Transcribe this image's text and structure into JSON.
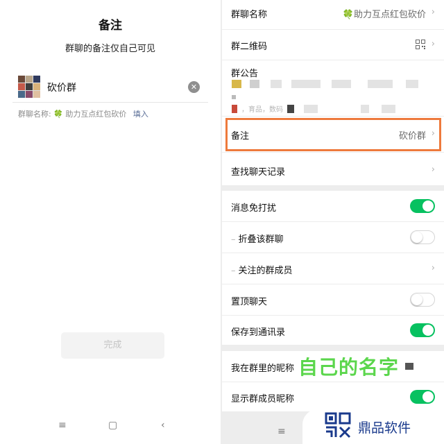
{
  "left": {
    "title": "备注",
    "subtitle": "群聊的备注仅自己可见",
    "remark_value": "砍价群",
    "name_label": "群聊名称:",
    "name_value": "助力互点红包砍价",
    "fill_link": "填入",
    "done_label": "完成",
    "nav": {
      "menu": "≡",
      "home": "▢",
      "back": "‹"
    }
  },
  "right": {
    "group_name_label": "群聊名称",
    "group_name_value": "助力互点红包砍价",
    "qr_label": "群二维码",
    "announcement_label": "群公告",
    "announcement_fragment": "，育品，数码",
    "remark_label": "备注",
    "remark_value": "砍价群",
    "search_history_label": "查找聊天记录",
    "mute_label": "消息免打扰",
    "fold_label": "折叠该群聊",
    "followed_label": "关注的群成员",
    "pin_label": "置顶聊天",
    "save_contacts_label": "保存到通讯录",
    "nickname_label": "我在群里的昵称",
    "show_nickname_label": "显示群成员昵称",
    "toggles": {
      "mute": true,
      "fold": false,
      "pin": false,
      "save_contacts": true,
      "show_nickname": true
    },
    "nav_menu": "≡"
  },
  "overlay": {
    "annotation": "自己的名字",
    "brand": "鼎品软件"
  },
  "colors": {
    "toggle_on": "#07c160",
    "highlight": "#ee7a3c",
    "annotation": "#5bd64c",
    "brand": "#1a3a8c"
  }
}
